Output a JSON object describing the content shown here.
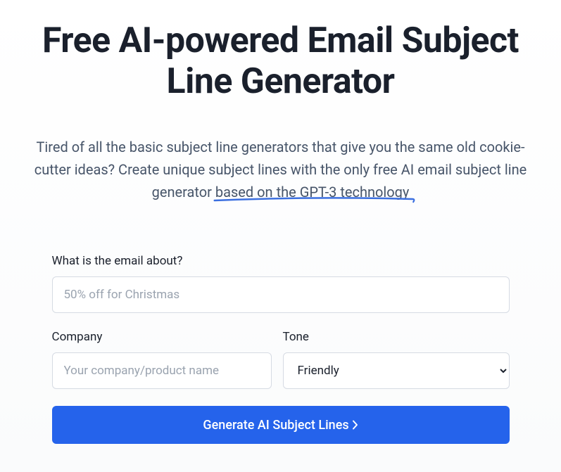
{
  "header": {
    "title": "Free AI-powered Email Subject Line Generator",
    "subtitle_prefix": "Tired of all the basic subject line generators that give you the same old cookie-cutter ideas? Create unique subject lines with the only free AI email subject line generator ",
    "subtitle_highlight": "based on the GPT-3 technology"
  },
  "form": {
    "about": {
      "label": "What is the email about?",
      "placeholder": "50% off for Christmas",
      "value": ""
    },
    "company": {
      "label": "Company",
      "placeholder": "Your company/product name",
      "value": ""
    },
    "tone": {
      "label": "Tone",
      "selected": "Friendly"
    },
    "submit_label": "Generate AI Subject Lines"
  },
  "colors": {
    "accent": "#2563eb",
    "underline": "#3b6fe0"
  }
}
